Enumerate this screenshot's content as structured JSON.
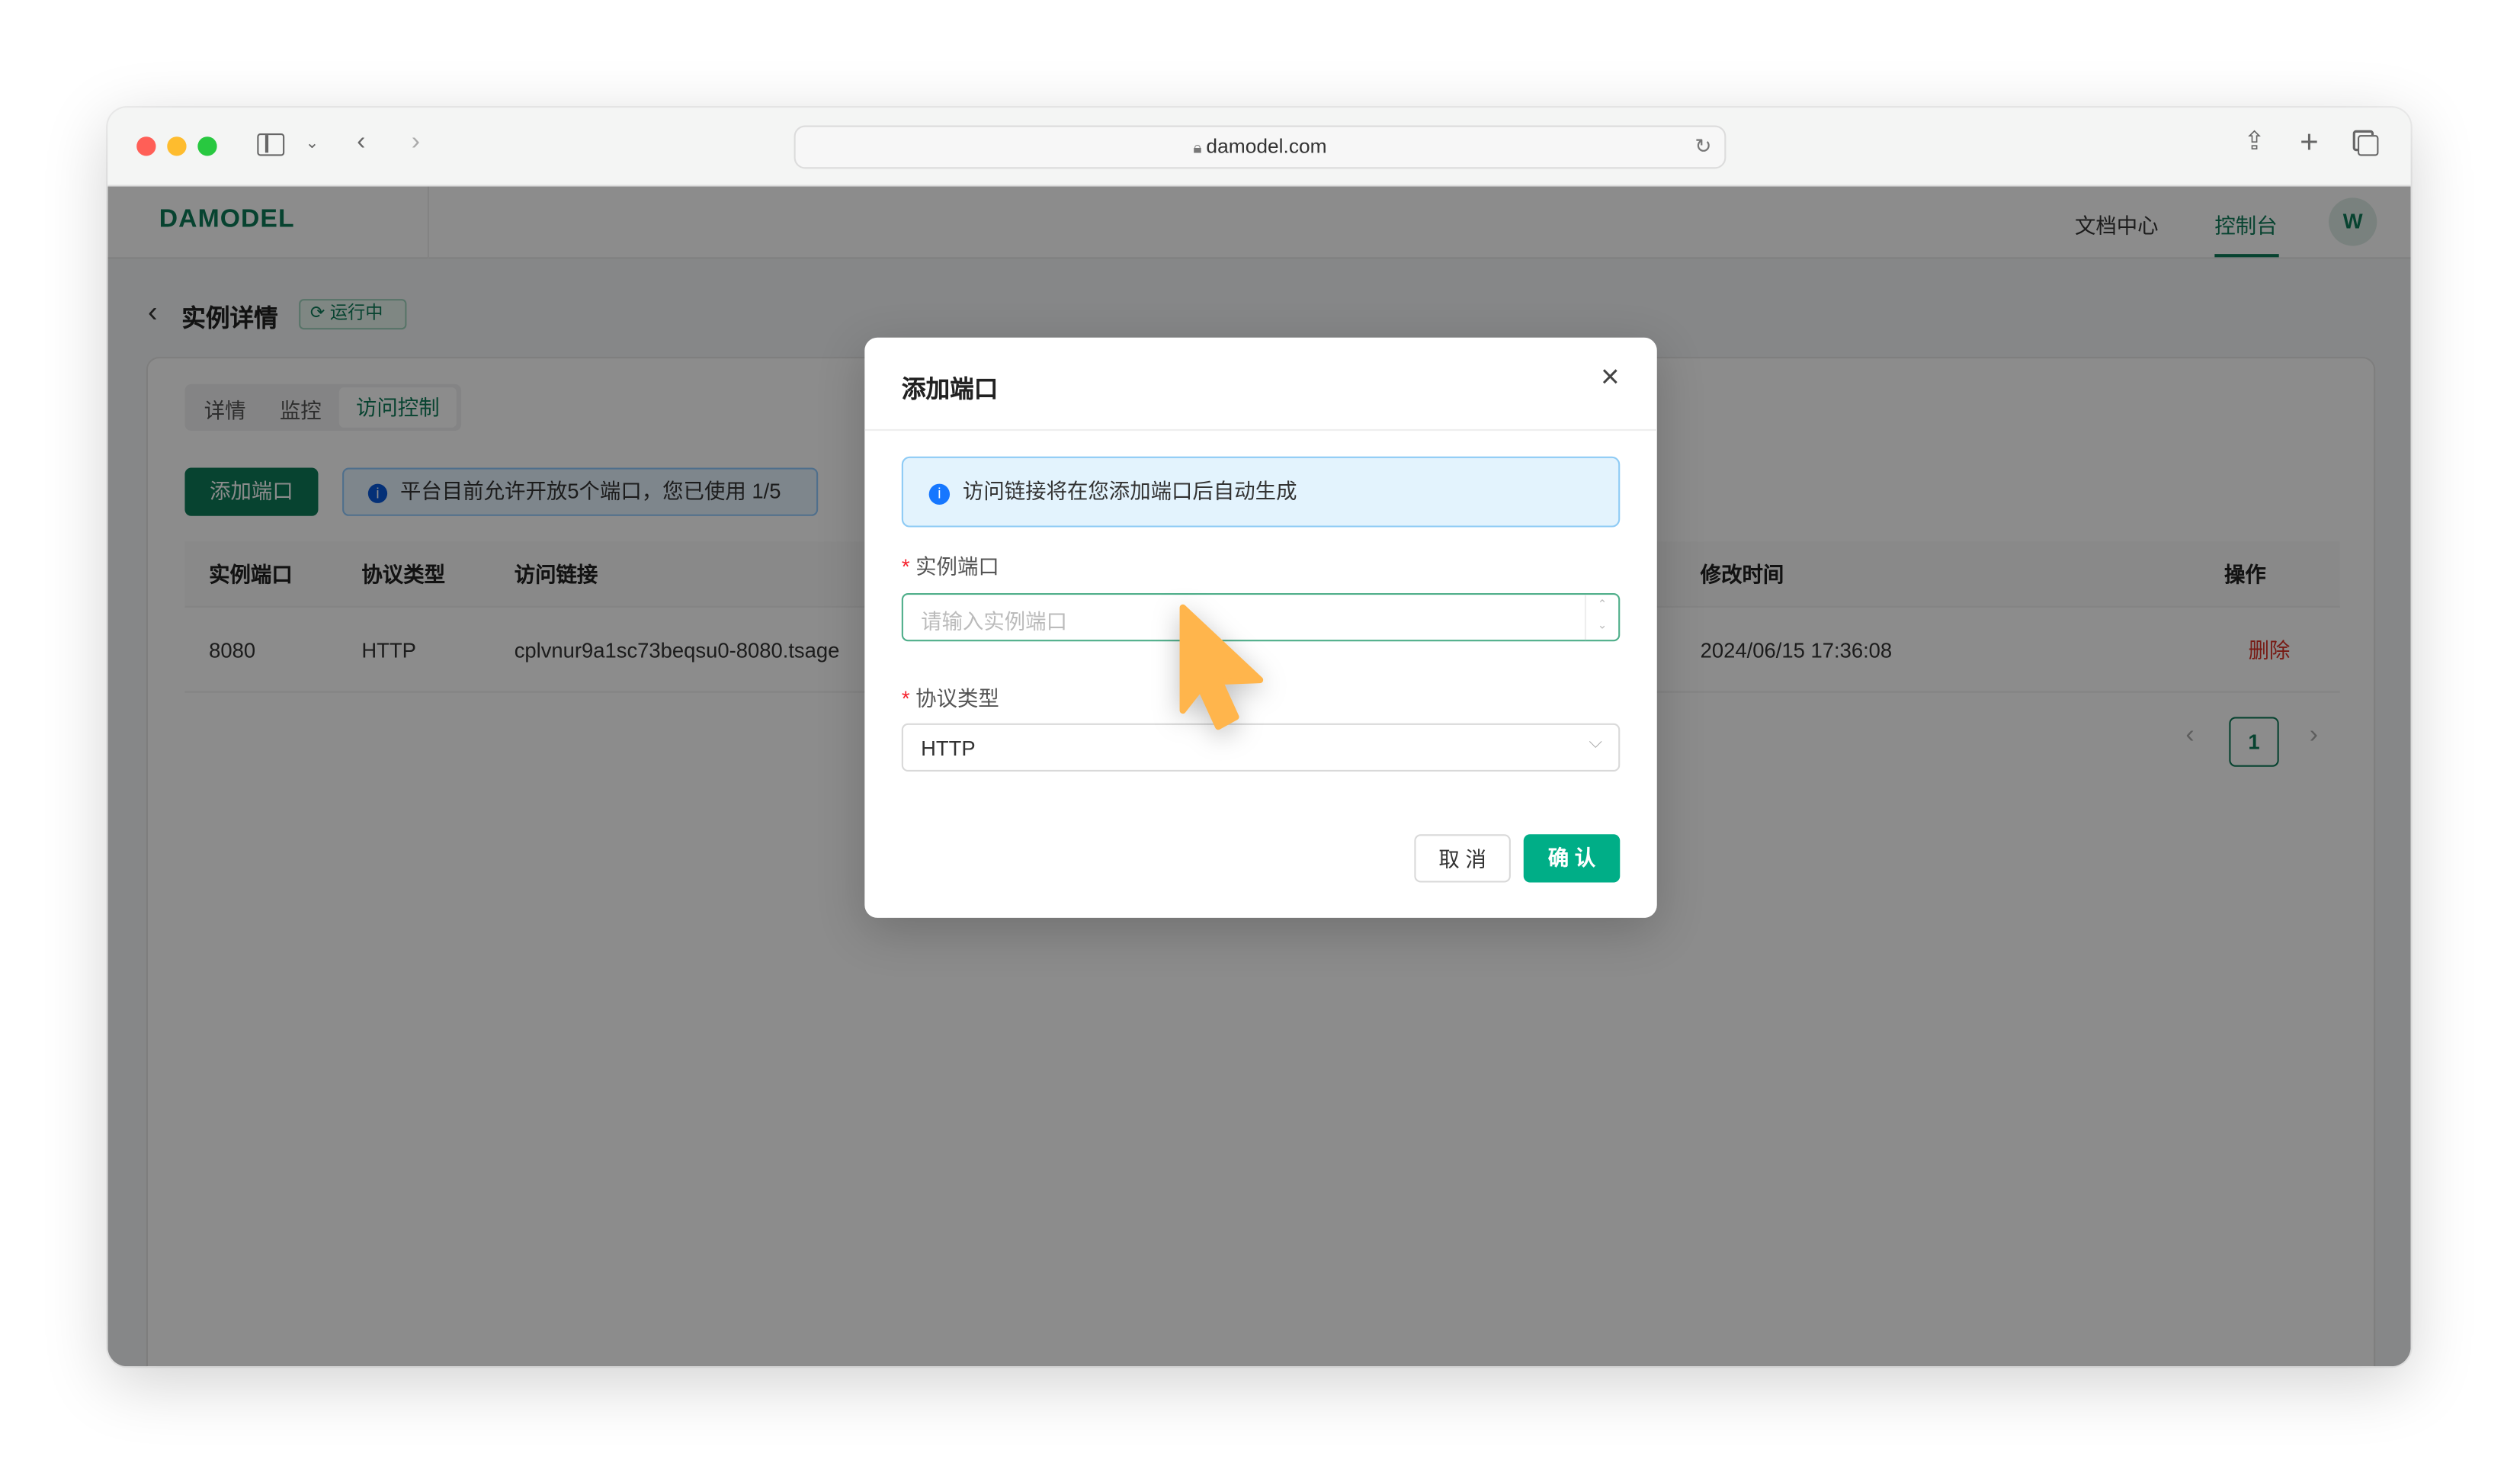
{
  "browser": {
    "url": "damodel.com",
    "icons": [
      "sidebar-icon",
      "chevron-down-icon",
      "back-icon",
      "forward-icon",
      "lock-icon",
      "reload-icon",
      "share-icon",
      "new-tab-icon",
      "tabs-overview-icon"
    ]
  },
  "header": {
    "logo": "DAMODEL",
    "nav": [
      {
        "label": "文档中心"
      },
      {
        "label": "控制台",
        "active": true
      }
    ],
    "avatar": "W"
  },
  "page": {
    "title": "实例详情",
    "status": "运行中",
    "tabs": [
      {
        "label": "详情"
      },
      {
        "label": "监控"
      },
      {
        "label": "访问控制",
        "active": true
      }
    ],
    "add_port_button": "添加端口",
    "quota_notice": "平台目前允许开放5个端口，您已使用 1/5",
    "table": {
      "columns": [
        "实例端口",
        "协议类型",
        "访问链接",
        "修改时间",
        "操作"
      ],
      "rows": [
        {
          "port": "8080",
          "protocol": "HTTP",
          "link": "cplvnur9a1sc73beqsu0-8080.tsage",
          "modified": "2024/06/15 17:36:08",
          "action": "删除"
        }
      ]
    },
    "pagination": {
      "current": "1"
    }
  },
  "modal": {
    "title": "添加端口",
    "info": "访问链接将在您添加端口后自动生成",
    "port_label": "实例端口",
    "port_placeholder": "请输入实例端口",
    "protocol_label": "协议类型",
    "protocol_value": "HTTP",
    "required_mark": "*",
    "cancel": "取 消",
    "confirm": "确 认"
  },
  "colors": {
    "brand": "#0d7a58",
    "confirm": "#00ae87",
    "danger": "#d93026",
    "info_bg": "#e3f3fd",
    "cursor": "#ffb54c"
  }
}
